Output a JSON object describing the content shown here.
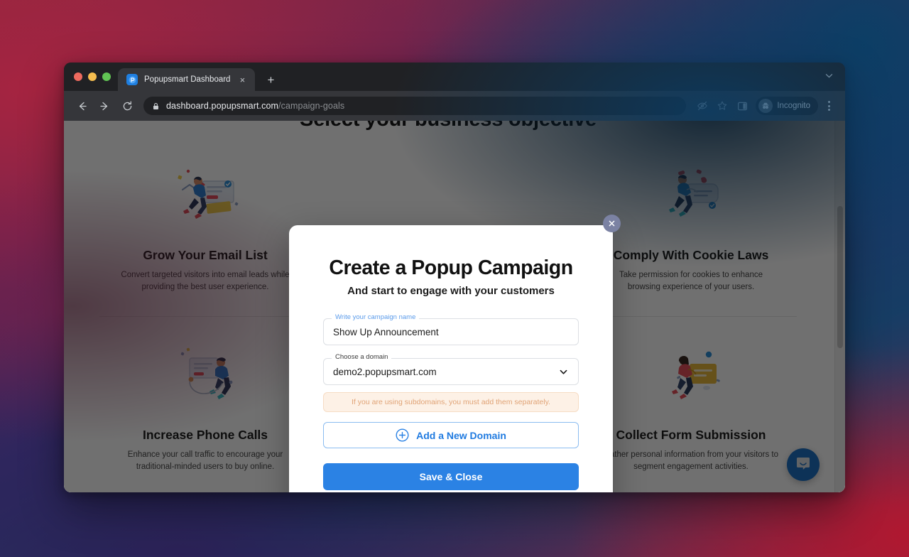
{
  "browser": {
    "tab": {
      "title": "Popupsmart Dashboard",
      "favicon": "popupsmart-favicon",
      "close": "×",
      "new_tab": "+"
    },
    "toolbar": {
      "back": "back-arrow",
      "forward": "forward-arrow",
      "reload": "reload-arrow",
      "lock": "lock-icon",
      "url_domain": "dashboard.popupsmart.com",
      "url_path": "/campaign-goals",
      "eye_slash": "eye-slash-icon",
      "bookmark": "star-icon",
      "side_panel": "side-panel-icon",
      "profile_label": "Incognito",
      "menu": "kebab-menu-icon"
    }
  },
  "page": {
    "title": "Select your business objective",
    "cards": [
      {
        "title": "Grow Your Email List",
        "desc": "Convert targeted visitors into email leads while providing the best user experience.",
        "art": "person-running-with-email-illustration"
      },
      {
        "title": "",
        "desc": "",
        "art": ""
      },
      {
        "title": "Comply With Cookie Laws",
        "desc": "Take permission for cookies to enhance browsing experience of your users.",
        "art": "person-with-cookie-banner-illustration"
      },
      {
        "title": "Increase Phone Calls",
        "desc": "Enhance your call traffic to encourage your traditional-minded users to buy online.",
        "art": "person-on-phone-illustration"
      },
      {
        "title": "",
        "desc": "",
        "art": ""
      },
      {
        "title": "Collect Form Submission",
        "desc": "Gather personal information from your visitors to segment engagement activities.",
        "art": "person-with-form-illustration"
      }
    ],
    "intercom": "chat-bubble-icon"
  },
  "modal": {
    "close": "close-icon",
    "title": "Create a Popup Campaign",
    "subtitle": "And start to engage with your customers",
    "campaign_name": {
      "label": "Write your campaign name",
      "value": "Show Up Announcement",
      "placeholder": "Write your campaign name"
    },
    "domain": {
      "label": "Choose a domain",
      "value": "demo2.popupsmart.com",
      "chevron": "chevron-down-icon"
    },
    "notice": "If you are using subdomains, you must add them separately.",
    "add_domain_label": "Add a New Domain",
    "add_domain_icon": "plus-circle-icon",
    "save_label": "Save & Close"
  },
  "colors": {
    "primary": "#2b82e4",
    "accent_link": "#1f7ae0",
    "notice_bg": "#fdf1e6",
    "notice_text": "#e0a376",
    "close_btn": "#7b82a3"
  }
}
